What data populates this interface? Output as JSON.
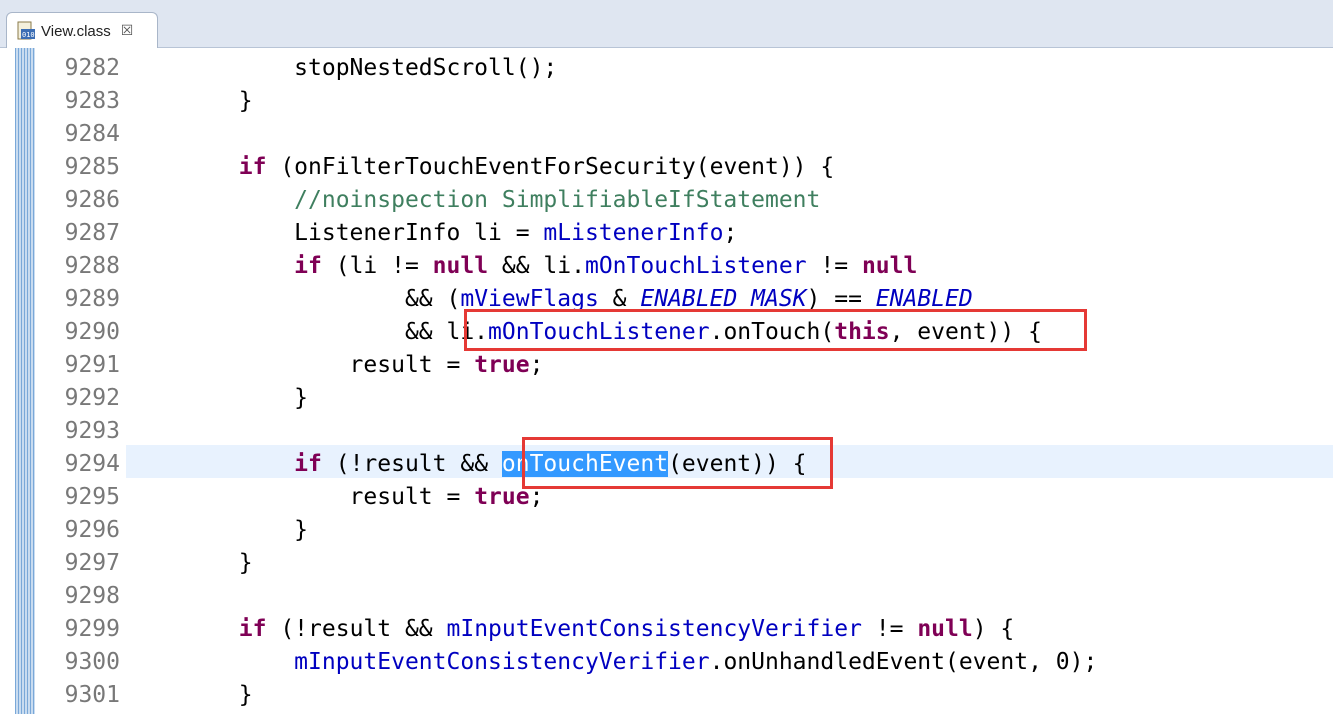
{
  "tab": {
    "title": "View.class",
    "close": "☒",
    "icon": "class-file-icon"
  },
  "lines": [
    {
      "num": "9282",
      "tokens": [
        {
          "t": "            stopNestedScroll();",
          "c": ""
        }
      ]
    },
    {
      "num": "9283",
      "tokens": [
        {
          "t": "        }",
          "c": ""
        }
      ]
    },
    {
      "num": "9284",
      "tokens": [
        {
          "t": "",
          "c": ""
        }
      ]
    },
    {
      "num": "9285",
      "tokens": [
        {
          "t": "        ",
          "c": ""
        },
        {
          "t": "if",
          "c": "kw"
        },
        {
          "t": " (onFilterTouchEventForSecurity(event)) {",
          "c": ""
        }
      ]
    },
    {
      "num": "9286",
      "tokens": [
        {
          "t": "            ",
          "c": ""
        },
        {
          "t": "//noinspection SimplifiableIfStatement",
          "c": "comment"
        }
      ]
    },
    {
      "num": "9287",
      "tokens": [
        {
          "t": "            ListenerInfo li = ",
          "c": ""
        },
        {
          "t": "mListenerInfo",
          "c": "field"
        },
        {
          "t": ";",
          "c": ""
        }
      ]
    },
    {
      "num": "9288",
      "tokens": [
        {
          "t": "            ",
          "c": ""
        },
        {
          "t": "if",
          "c": "kw"
        },
        {
          "t": " (li != ",
          "c": ""
        },
        {
          "t": "null",
          "c": "kw"
        },
        {
          "t": " && li.",
          "c": ""
        },
        {
          "t": "mOnTouchListener",
          "c": "field"
        },
        {
          "t": " != ",
          "c": ""
        },
        {
          "t": "null",
          "c": "kw"
        }
      ]
    },
    {
      "num": "9289",
      "tokens": [
        {
          "t": "                    && (",
          "c": ""
        },
        {
          "t": "mViewFlags",
          "c": "field"
        },
        {
          "t": " & ",
          "c": ""
        },
        {
          "t": "ENABLED_MASK",
          "c": "static"
        },
        {
          "t": ") == ",
          "c": ""
        },
        {
          "t": "ENABLED",
          "c": "static"
        }
      ]
    },
    {
      "num": "9290",
      "tokens": [
        {
          "t": "                    && li.",
          "c": ""
        },
        {
          "t": "mOnTouchListener",
          "c": "field"
        },
        {
          "t": ".onTouch(",
          "c": ""
        },
        {
          "t": "this",
          "c": "kw"
        },
        {
          "t": ", event)) {",
          "c": ""
        }
      ]
    },
    {
      "num": "9291",
      "tokens": [
        {
          "t": "                result = ",
          "c": ""
        },
        {
          "t": "true",
          "c": "kw"
        },
        {
          "t": ";",
          "c": ""
        }
      ]
    },
    {
      "num": "9292",
      "tokens": [
        {
          "t": "            }",
          "c": ""
        }
      ]
    },
    {
      "num": "9293",
      "tokens": [
        {
          "t": "",
          "c": ""
        }
      ]
    },
    {
      "num": "9294",
      "tokens": [
        {
          "t": "            ",
          "c": ""
        },
        {
          "t": "if",
          "c": "kw"
        },
        {
          "t": " (!result && ",
          "c": ""
        },
        {
          "t": "onTouchEvent",
          "c": "sel"
        },
        {
          "t": "(event)) {",
          "c": ""
        }
      ]
    },
    {
      "num": "9295",
      "tokens": [
        {
          "t": "                result = ",
          "c": ""
        },
        {
          "t": "true",
          "c": "kw"
        },
        {
          "t": ";",
          "c": ""
        }
      ]
    },
    {
      "num": "9296",
      "tokens": [
        {
          "t": "            }",
          "c": ""
        }
      ]
    },
    {
      "num": "9297",
      "tokens": [
        {
          "t": "        }",
          "c": ""
        }
      ]
    },
    {
      "num": "9298",
      "tokens": [
        {
          "t": "",
          "c": ""
        }
      ]
    },
    {
      "num": "9299",
      "tokens": [
        {
          "t": "        ",
          "c": ""
        },
        {
          "t": "if",
          "c": "kw"
        },
        {
          "t": " (!result && ",
          "c": ""
        },
        {
          "t": "mInputEventConsistencyVerifier",
          "c": "field"
        },
        {
          "t": " != ",
          "c": ""
        },
        {
          "t": "null",
          "c": "kw"
        },
        {
          "t": ") {",
          "c": ""
        }
      ]
    },
    {
      "num": "9300",
      "tokens": [
        {
          "t": "            ",
          "c": ""
        },
        {
          "t": "mInputEventConsistencyVerifier",
          "c": "field"
        },
        {
          "t": ".onUnhandledEvent(event, 0);",
          "c": ""
        }
      ]
    },
    {
      "num": "9301",
      "tokens": [
        {
          "t": "        }",
          "c": ""
        }
      ]
    }
  ],
  "colors": {
    "keyword": "#7f0055",
    "comment": "#3f7f5f",
    "field": "#0000c0",
    "selection": "#3399ff",
    "highlight_box": "#e53935"
  }
}
